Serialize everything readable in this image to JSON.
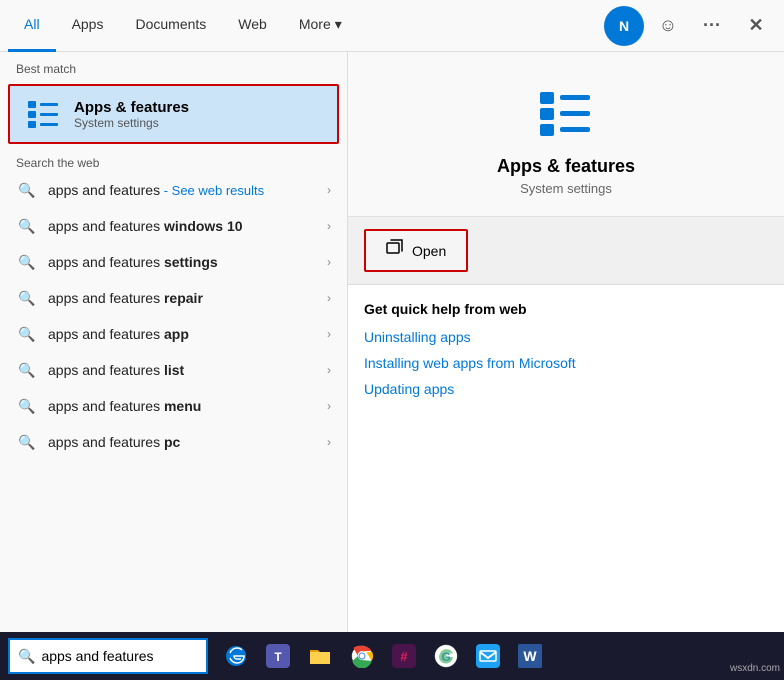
{
  "topNav": {
    "tabs": [
      {
        "id": "all",
        "label": "All",
        "active": true
      },
      {
        "id": "apps",
        "label": "Apps",
        "active": false
      },
      {
        "id": "documents",
        "label": "Documents",
        "active": false
      },
      {
        "id": "web",
        "label": "Web",
        "active": false
      },
      {
        "id": "more",
        "label": "More",
        "active": false
      }
    ],
    "moreChevron": "▾",
    "userInitial": "N",
    "ellipsis": "···",
    "close": "✕"
  },
  "leftPanel": {
    "bestMatchLabel": "Best match",
    "bestMatch": {
      "title": "Apps & features",
      "subtitle": "System settings"
    },
    "searchWebLabel": "Search the web",
    "webResults": [
      {
        "prefix": "apps and features",
        "suffix": " - See web results",
        "suffixClass": "see-web-results"
      },
      {
        "prefix": "apps and features ",
        "bold": "windows 10",
        "suffix": ""
      },
      {
        "prefix": "apps and features ",
        "bold": "settings",
        "suffix": ""
      },
      {
        "prefix": "apps and features ",
        "bold": "repair",
        "suffix": ""
      },
      {
        "prefix": "apps and features ",
        "bold": "app",
        "suffix": ""
      },
      {
        "prefix": "apps and features ",
        "bold": "list",
        "suffix": ""
      },
      {
        "prefix": "apps and features ",
        "bold": "menu",
        "suffix": ""
      },
      {
        "prefix": "apps and features ",
        "bold": "pc",
        "suffix": ""
      }
    ]
  },
  "rightPanel": {
    "appTitle": "Apps & features",
    "appSubtitle": "System settings",
    "openLabel": "Open",
    "quickHelp": {
      "title": "Get quick help from web",
      "links": [
        "Uninstalling apps",
        "Installing web apps from Microsoft",
        "Updating apps"
      ]
    }
  },
  "taskbar": {
    "searchValue": "apps and features",
    "searchPlaceholder": "apps and features",
    "icons": [
      {
        "name": "edge-icon",
        "symbol": "🌐"
      },
      {
        "name": "teams-icon",
        "symbol": "💬"
      },
      {
        "name": "folder-icon",
        "symbol": "📁"
      },
      {
        "name": "chrome-icon",
        "symbol": "⬤"
      },
      {
        "name": "slack-icon",
        "symbol": "⁑"
      },
      {
        "name": "google-icon",
        "symbol": "G"
      },
      {
        "name": "email-icon",
        "symbol": "✉"
      },
      {
        "name": "word-icon",
        "symbol": "W"
      }
    ]
  },
  "watermark": "wsxdn.com"
}
